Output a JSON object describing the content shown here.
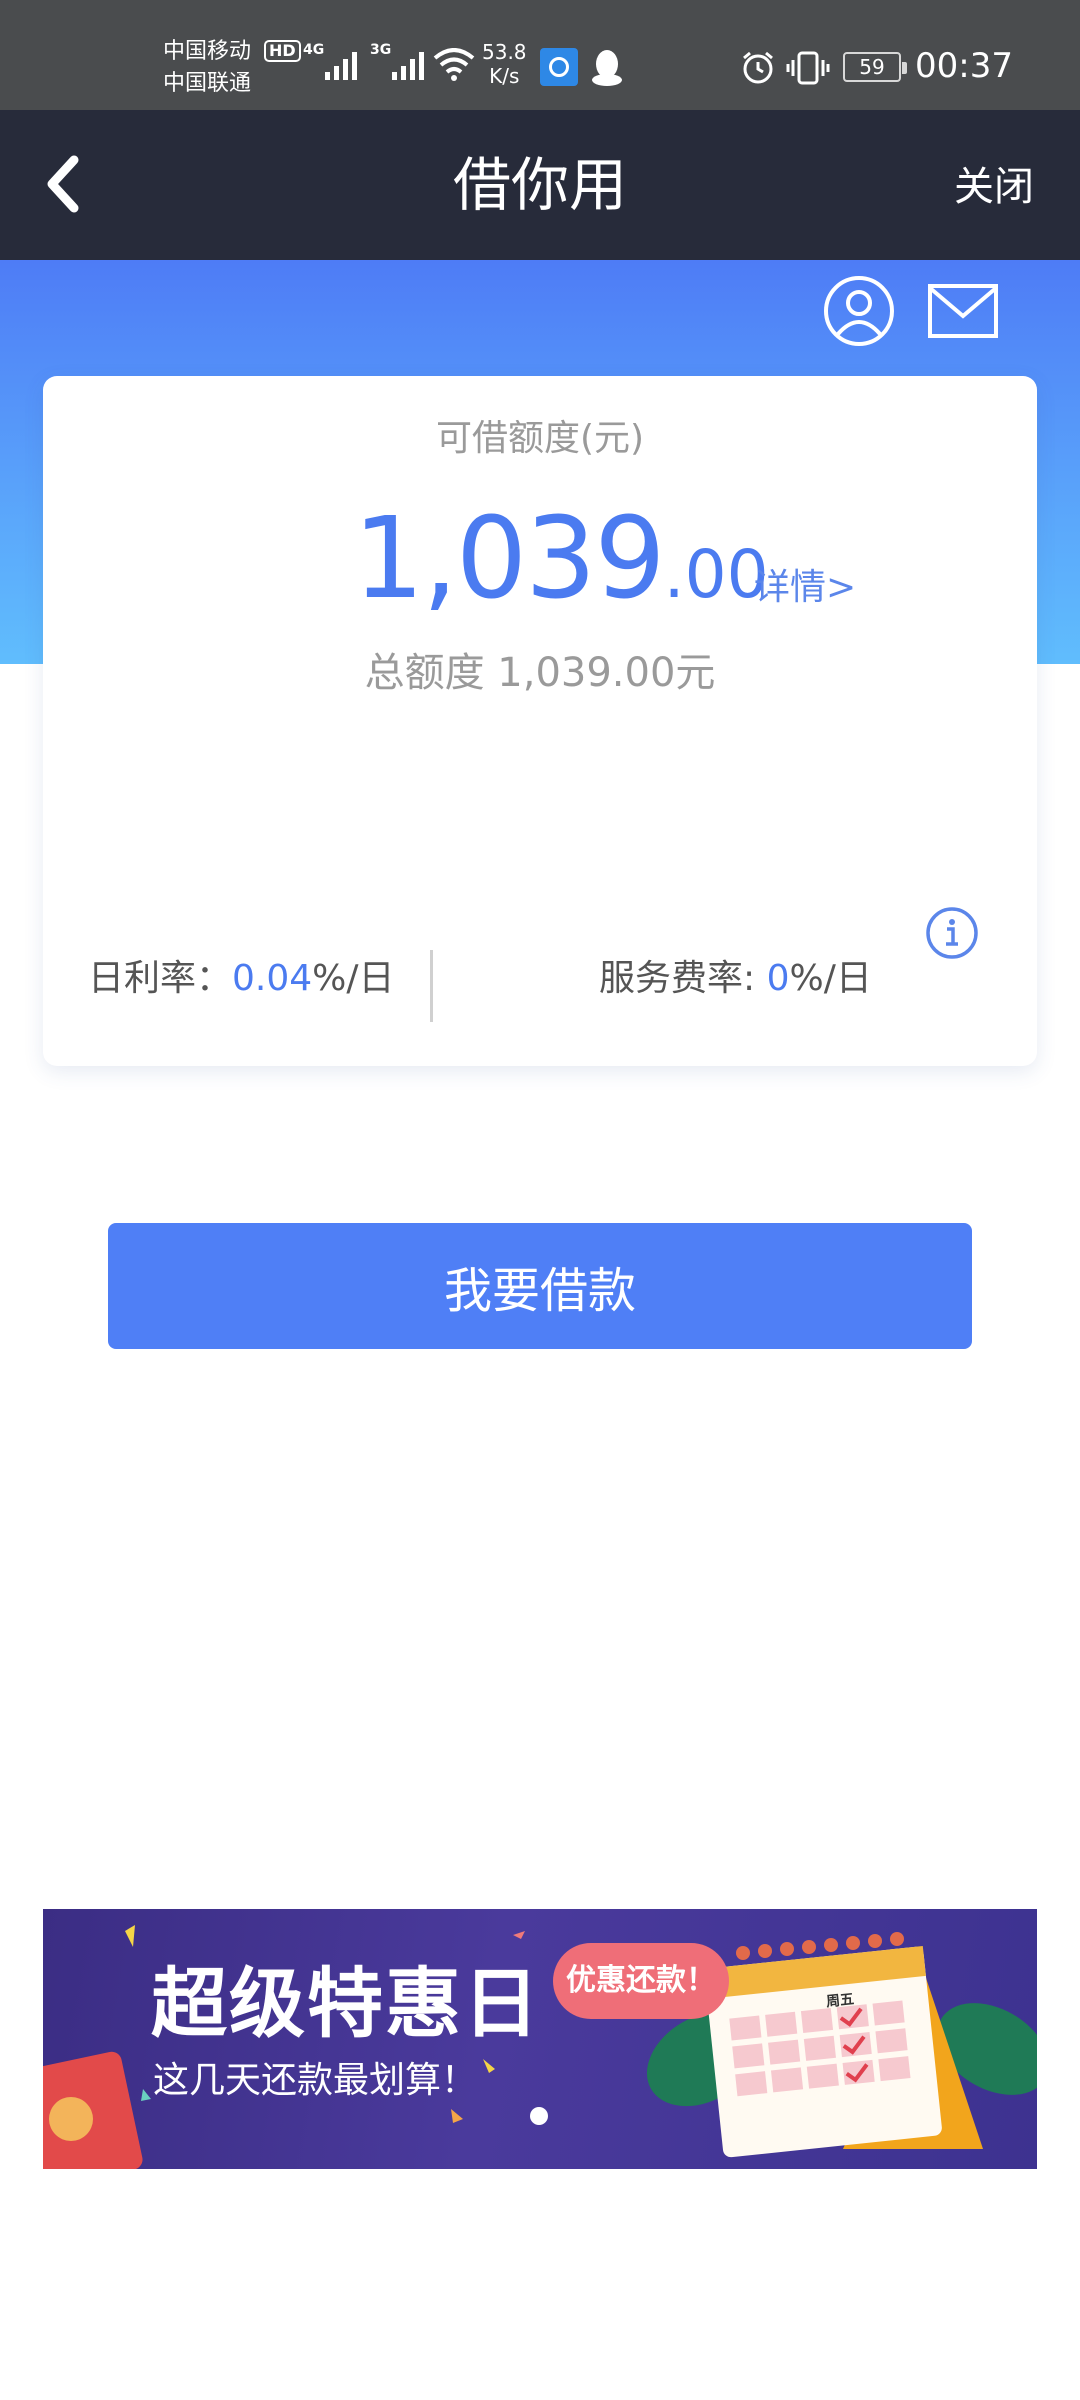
{
  "status_bar": {
    "carrier_1": "中国移动",
    "carrier_2": "中国联通",
    "hd_badge": "HD",
    "network_1": "4G",
    "network_2": "3G",
    "speed_value": "53.8",
    "speed_unit": "K/s",
    "battery": "59",
    "time": "00:37"
  },
  "nav": {
    "title": "借你用",
    "close_label": "关闭"
  },
  "card": {
    "available_label": "可借额度(元)",
    "amount_integer": "1,039",
    "amount_decimal": ".00",
    "detail_link": "详情>",
    "total_label": "总额度 1,039.00元",
    "daily_rate_label": "日利率：",
    "daily_rate_value": "0.04",
    "daily_rate_unit": "%/日",
    "service_fee_label": "服务费率: ",
    "service_fee_value": "0",
    "service_fee_unit": "%/日"
  },
  "borrow_button": "我要借款",
  "banner": {
    "title": "超级特惠日",
    "subtitle": "这几天还款最划算！",
    "bubble": "优惠还款！",
    "calendar_day": "周五",
    "slide_count": 1,
    "active_slide": 1
  },
  "colors": {
    "accent": "#4f7ff6",
    "nav_bg": "#272b3a",
    "status_bg": "#4a4c4e",
    "banner_bg": "#3f3290"
  }
}
